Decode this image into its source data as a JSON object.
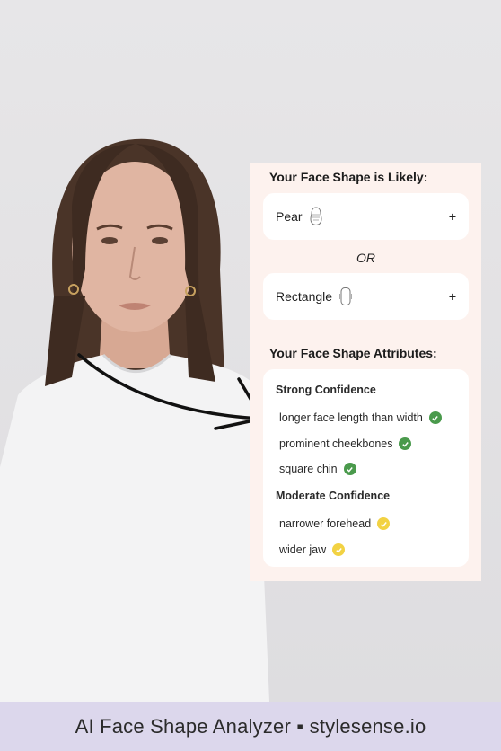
{
  "panel": {
    "likely_title": "Your Face Shape is Likely:",
    "shapes": [
      {
        "label": "Pear",
        "icon": "pear-face-icon",
        "action": "+"
      },
      {
        "label": "Rectangle",
        "icon": "rectangle-face-icon",
        "action": "+"
      }
    ],
    "or_label": "OR",
    "attributes_title": "Your Face Shape Attributes:",
    "strong": {
      "title": "Strong Confidence",
      "items": [
        "longer face length than width",
        "prominent cheekbones",
        "square chin"
      ],
      "check_color": "#4a9a4c"
    },
    "moderate": {
      "title": "Moderate Confidence",
      "items": [
        "narrower forehead",
        "wider jaw"
      ],
      "check_color": "#f2d243"
    }
  },
  "footer": {
    "brand": "AI Face Shape Analyzer ▪ stylesense.io"
  },
  "colors": {
    "panel_bg": "#fdf2ee",
    "footer_bg": "#dcd7ec"
  }
}
